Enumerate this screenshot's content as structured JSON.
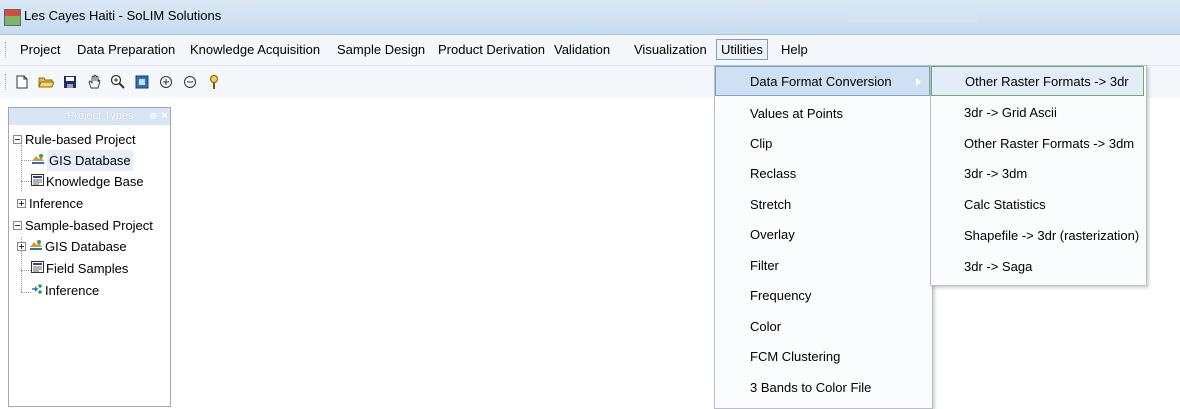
{
  "window": {
    "title": "Les Cayes Haiti - SoLIM Solutions",
    "ghost_title": "Manual (SoLIM) - Word"
  },
  "menubar": {
    "items": [
      {
        "label": "Project"
      },
      {
        "label": "Data Preparation"
      },
      {
        "label": "Knowledge Acquisition"
      },
      {
        "label": "Sample Design"
      },
      {
        "label": "Product Derivation"
      },
      {
        "label": "Validation"
      },
      {
        "label": "Visualization"
      },
      {
        "label": "Utilities"
      },
      {
        "label": "Help"
      }
    ]
  },
  "toolbar": {
    "buttons": [
      "new-file-icon",
      "open-folder-icon",
      "save-icon",
      "pan-hand-icon",
      "zoom-in-magnifier-icon",
      "full-extent-icon",
      "zoom-in-icon",
      "zoom-out-icon",
      "identify-icon"
    ],
    "glyphs": [
      "🗋",
      "📂",
      "💾",
      "✋",
      "🔍",
      "▣",
      "⊕",
      "⊖",
      "💡"
    ]
  },
  "panel": {
    "title": "Project Types",
    "pin": "⊕ ✕",
    "tree": [
      {
        "label": "Rule-based Project",
        "expander": "minus"
      },
      {
        "label": "GIS Database",
        "icon": "gis-icon"
      },
      {
        "label": "Knowledge Base",
        "icon": "knowledge-icon"
      },
      {
        "label": "Inference",
        "expander": "plus"
      },
      {
        "label": "Sample-based Project",
        "expander": "minus"
      },
      {
        "label": "GIS Database",
        "icon": "gis-icon",
        "expander": "plus"
      },
      {
        "label": "Field Samples",
        "icon": "samples-icon"
      },
      {
        "label": "Inference",
        "icon": "inference-icon"
      }
    ]
  },
  "utilities_menu": {
    "items": [
      "Data Format Conversion",
      "Values at Points",
      "Clip",
      "Reclass",
      "Stretch",
      "Overlay",
      "Filter",
      "Frequency",
      "Color",
      "FCM Clustering",
      "3 Bands to Color File"
    ]
  },
  "conversion_submenu": {
    "items": [
      "Other Raster Formats -> 3dr",
      "3dr -> Grid Ascii",
      "Other Raster Formats -> 3dm",
      "3dr -> 3dm",
      "Calc Statistics",
      "Shapefile -> 3dr (rasterization)",
      "3dr -> Saga"
    ]
  },
  "colors": {
    "menu_highlight": "#cfe0f5",
    "title_bar": "#c6dcf0",
    "panel_header": "#d8e5f4"
  }
}
